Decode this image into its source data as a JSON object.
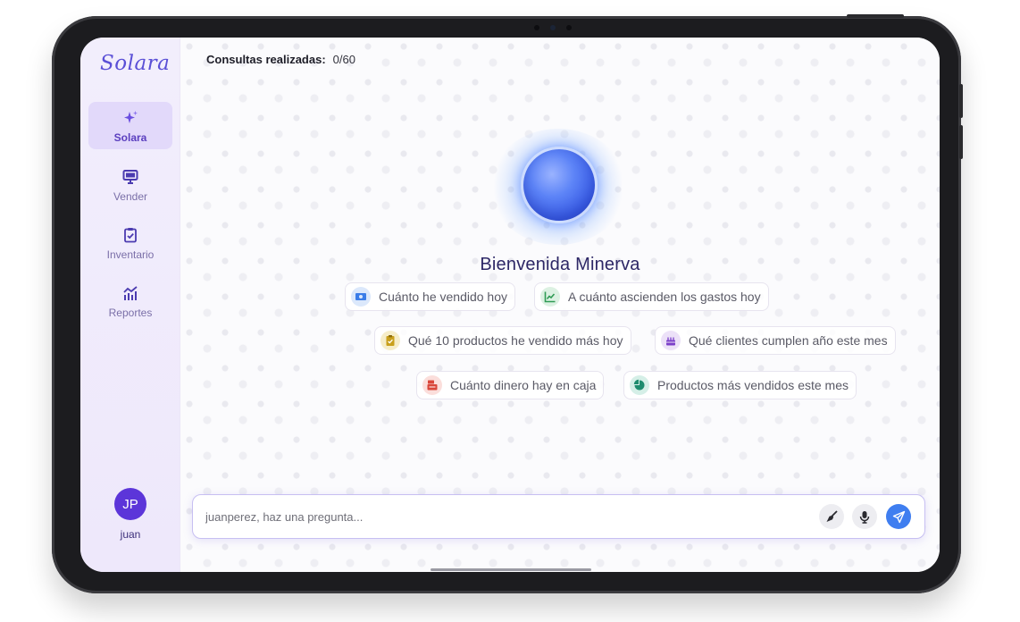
{
  "app": {
    "logo": "Solara"
  },
  "sidebar": {
    "items": [
      {
        "label": "Solara",
        "icon": "sparkles-icon",
        "active": true
      },
      {
        "label": "Vender",
        "icon": "monitor-icon",
        "active": false
      },
      {
        "label": "Inventario",
        "icon": "clipboard-check-icon",
        "active": false
      },
      {
        "label": "Reportes",
        "icon": "bar-chart-icon",
        "active": false
      }
    ],
    "user": {
      "initials": "JP",
      "name": "juan"
    }
  },
  "header": {
    "counter_label": "Consultas realizadas:",
    "counter_value": "0/60"
  },
  "main": {
    "welcome": "Bienvenida Minerva",
    "suggestions": [
      {
        "label": "Cuánto he vendido hoy",
        "icon": "cash-icon",
        "color": "#3b7de8"
      },
      {
        "label": "A cuánto ascienden los gastos hoy",
        "icon": "line-chart-icon",
        "color": "#2f9b54"
      },
      {
        "label": "Qué 10 productos he vendido más hoy",
        "icon": "clipboard-icon",
        "color": "#c9a01c"
      },
      {
        "label": "Qué clientes cumplen año este mes",
        "icon": "cake-icon",
        "color": "#7b3fc9"
      },
      {
        "label": "Cuánto dinero hay en caja",
        "icon": "cash-register-icon",
        "color": "#d9463a"
      },
      {
        "label": "Productos más vendidos este mes",
        "icon": "pie-chart-icon",
        "color": "#1e8c6e"
      }
    ]
  },
  "input": {
    "placeholder": "juanperez, haz una pregunta..."
  },
  "colors": {
    "accent": "#5c35d9",
    "send": "#3f7ef0",
    "sidebar_bg": "#f2eefc"
  }
}
